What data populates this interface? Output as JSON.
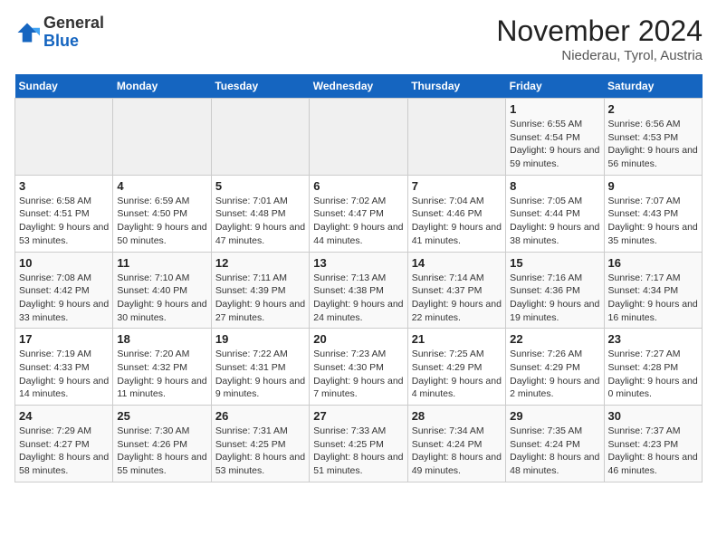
{
  "header": {
    "logo": {
      "line1": "General",
      "line2": "Blue"
    },
    "title": "November 2024",
    "subtitle": "Niederau, Tyrol, Austria"
  },
  "weekdays": [
    "Sunday",
    "Monday",
    "Tuesday",
    "Wednesday",
    "Thursday",
    "Friday",
    "Saturday"
  ],
  "weeks": [
    [
      {
        "day": "",
        "info": ""
      },
      {
        "day": "",
        "info": ""
      },
      {
        "day": "",
        "info": ""
      },
      {
        "day": "",
        "info": ""
      },
      {
        "day": "",
        "info": ""
      },
      {
        "day": "1",
        "info": "Sunrise: 6:55 AM\nSunset: 4:54 PM\nDaylight: 9 hours and 59 minutes."
      },
      {
        "day": "2",
        "info": "Sunrise: 6:56 AM\nSunset: 4:53 PM\nDaylight: 9 hours and 56 minutes."
      }
    ],
    [
      {
        "day": "3",
        "info": "Sunrise: 6:58 AM\nSunset: 4:51 PM\nDaylight: 9 hours and 53 minutes."
      },
      {
        "day": "4",
        "info": "Sunrise: 6:59 AM\nSunset: 4:50 PM\nDaylight: 9 hours and 50 minutes."
      },
      {
        "day": "5",
        "info": "Sunrise: 7:01 AM\nSunset: 4:48 PM\nDaylight: 9 hours and 47 minutes."
      },
      {
        "day": "6",
        "info": "Sunrise: 7:02 AM\nSunset: 4:47 PM\nDaylight: 9 hours and 44 minutes."
      },
      {
        "day": "7",
        "info": "Sunrise: 7:04 AM\nSunset: 4:46 PM\nDaylight: 9 hours and 41 minutes."
      },
      {
        "day": "8",
        "info": "Sunrise: 7:05 AM\nSunset: 4:44 PM\nDaylight: 9 hours and 38 minutes."
      },
      {
        "day": "9",
        "info": "Sunrise: 7:07 AM\nSunset: 4:43 PM\nDaylight: 9 hours and 35 minutes."
      }
    ],
    [
      {
        "day": "10",
        "info": "Sunrise: 7:08 AM\nSunset: 4:42 PM\nDaylight: 9 hours and 33 minutes."
      },
      {
        "day": "11",
        "info": "Sunrise: 7:10 AM\nSunset: 4:40 PM\nDaylight: 9 hours and 30 minutes."
      },
      {
        "day": "12",
        "info": "Sunrise: 7:11 AM\nSunset: 4:39 PM\nDaylight: 9 hours and 27 minutes."
      },
      {
        "day": "13",
        "info": "Sunrise: 7:13 AM\nSunset: 4:38 PM\nDaylight: 9 hours and 24 minutes."
      },
      {
        "day": "14",
        "info": "Sunrise: 7:14 AM\nSunset: 4:37 PM\nDaylight: 9 hours and 22 minutes."
      },
      {
        "day": "15",
        "info": "Sunrise: 7:16 AM\nSunset: 4:36 PM\nDaylight: 9 hours and 19 minutes."
      },
      {
        "day": "16",
        "info": "Sunrise: 7:17 AM\nSunset: 4:34 PM\nDaylight: 9 hours and 16 minutes."
      }
    ],
    [
      {
        "day": "17",
        "info": "Sunrise: 7:19 AM\nSunset: 4:33 PM\nDaylight: 9 hours and 14 minutes."
      },
      {
        "day": "18",
        "info": "Sunrise: 7:20 AM\nSunset: 4:32 PM\nDaylight: 9 hours and 11 minutes."
      },
      {
        "day": "19",
        "info": "Sunrise: 7:22 AM\nSunset: 4:31 PM\nDaylight: 9 hours and 9 minutes."
      },
      {
        "day": "20",
        "info": "Sunrise: 7:23 AM\nSunset: 4:30 PM\nDaylight: 9 hours and 7 minutes."
      },
      {
        "day": "21",
        "info": "Sunrise: 7:25 AM\nSunset: 4:29 PM\nDaylight: 9 hours and 4 minutes."
      },
      {
        "day": "22",
        "info": "Sunrise: 7:26 AM\nSunset: 4:29 PM\nDaylight: 9 hours and 2 minutes."
      },
      {
        "day": "23",
        "info": "Sunrise: 7:27 AM\nSunset: 4:28 PM\nDaylight: 9 hours and 0 minutes."
      }
    ],
    [
      {
        "day": "24",
        "info": "Sunrise: 7:29 AM\nSunset: 4:27 PM\nDaylight: 8 hours and 58 minutes."
      },
      {
        "day": "25",
        "info": "Sunrise: 7:30 AM\nSunset: 4:26 PM\nDaylight: 8 hours and 55 minutes."
      },
      {
        "day": "26",
        "info": "Sunrise: 7:31 AM\nSunset: 4:25 PM\nDaylight: 8 hours and 53 minutes."
      },
      {
        "day": "27",
        "info": "Sunrise: 7:33 AM\nSunset: 4:25 PM\nDaylight: 8 hours and 51 minutes."
      },
      {
        "day": "28",
        "info": "Sunrise: 7:34 AM\nSunset: 4:24 PM\nDaylight: 8 hours and 49 minutes."
      },
      {
        "day": "29",
        "info": "Sunrise: 7:35 AM\nSunset: 4:24 PM\nDaylight: 8 hours and 48 minutes."
      },
      {
        "day": "30",
        "info": "Sunrise: 7:37 AM\nSunset: 4:23 PM\nDaylight: 8 hours and 46 minutes."
      }
    ]
  ]
}
